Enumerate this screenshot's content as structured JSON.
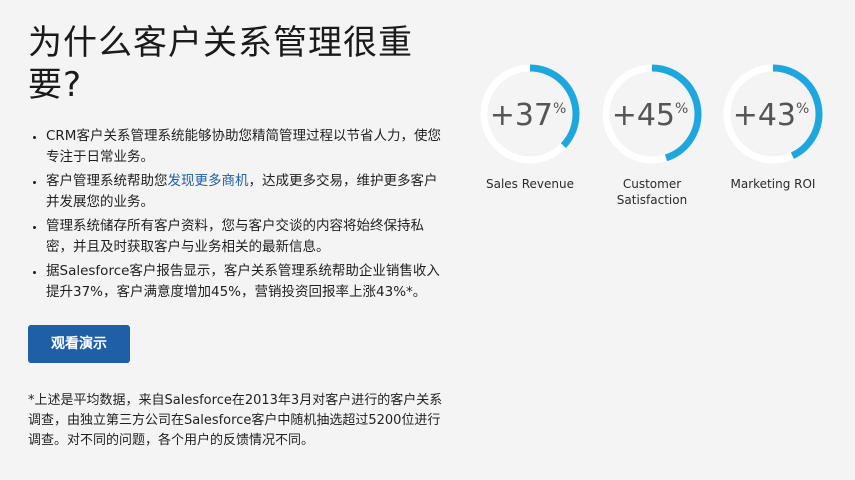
{
  "heading": "为什么客户关系管理很重要?",
  "bullets": [
    {
      "text": "CRM客户关系管理系统能够协助您精简管理过程以节省人力，使您专注于日常业务。"
    },
    {
      "pre": "客户管理系统帮助您",
      "link": "发现更多商机",
      "post": "，达成更多交易，维护更多客户并发展您的业务。"
    },
    {
      "text": "管理系统储存所有客户资料，您与客户交谈的内容将始终保持私密，并且及时获取客户与业务相关的最新信息。"
    },
    {
      "text": "据Salesforce客户报告显示，客户关系管理系统帮助企业销售收入提升37%，客户满意度增加45%，营销投资回报率上涨43%*。"
    }
  ],
  "cta_label": "观看演示",
  "footnote": "*上述是平均数据，来自Salesforce在2013年3月对客户进行的客户关系调查，由独立第三方公司在Salesforce客户中随机抽选超过5200位进行调查。对不同的问题，各个用户的反馈情况不同。",
  "stats": [
    {
      "value": "+37",
      "unit": "%",
      "label": "Sales Revenue",
      "fraction": 0.37
    },
    {
      "value": "+45",
      "unit": "%",
      "label": "Customer Satisfaction",
      "fraction": 0.45
    },
    {
      "value": "+43",
      "unit": "%",
      "label": "Marketing ROI",
      "fraction": 0.43
    }
  ],
  "colors": {
    "accent": "#1f5fa8",
    "ring": "#1ea7df",
    "ring_track": "#ffffff"
  }
}
